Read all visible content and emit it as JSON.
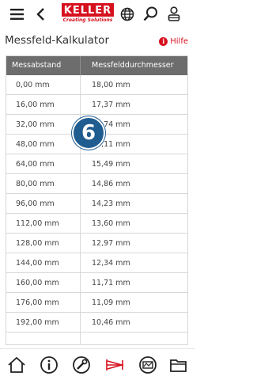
{
  "header": {
    "logo_text": "KELLER",
    "logo_tagline": "Creating Solutions",
    "brand_color": "#d6111e"
  },
  "page": {
    "title": "Messfeld-Kalkulator",
    "help_label": "Hilfe",
    "help_icon_glyph": "i"
  },
  "table": {
    "header_color": "#6d6d6d",
    "columns": [
      "Messabstand",
      "Messfelddurchmesser"
    ],
    "rows": [
      [
        "0,00 mm",
        "18,00 mm"
      ],
      [
        "16,00 mm",
        "17,37 mm"
      ],
      [
        "32,00 mm",
        "16,74 mm"
      ],
      [
        "48,00 mm",
        "16,11 mm"
      ],
      [
        "64,00 mm",
        "15,49 mm"
      ],
      [
        "80,00 mm",
        "14,86 mm"
      ],
      [
        "96,00 mm",
        "14,23 mm"
      ],
      [
        "112,00 mm",
        "13,60 mm"
      ],
      [
        "128,00 mm",
        "12,97 mm"
      ],
      [
        "144,00 mm",
        "12,34 mm"
      ],
      [
        "160,00 mm",
        "11,71 mm"
      ],
      [
        "176,00 mm",
        "11,09 mm"
      ],
      [
        "192,00 mm",
        "10,46 mm"
      ]
    ]
  },
  "overlay_badge": {
    "text": "6",
    "color": "#1f5c90"
  },
  "icons": {
    "top": [
      "menu-icon",
      "back-icon",
      "globe-icon",
      "search-icon",
      "user-icon"
    ],
    "bottom": [
      "home-icon",
      "info-icon",
      "tools-icon",
      "calculator-icon",
      "device-icon",
      "folder-icon"
    ]
  }
}
